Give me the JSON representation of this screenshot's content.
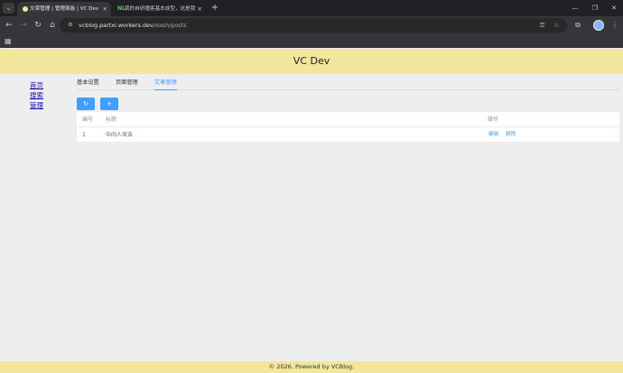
{
  "browser": {
    "tabs": [
      {
        "title": "文章管理 | 管理面板 | VC Dev",
        "active": true
      },
      {
        "title": "我的自研播客基本成型，这是我",
        "active": false,
        "favicon": "NL"
      }
    ],
    "url_host": "vcblog.partxi.workers.dev",
    "url_path": "/dash/posts"
  },
  "site": {
    "title": "VC Dev",
    "footer": "© 2026. Powered by VCBlog."
  },
  "sidebar": {
    "items": [
      {
        "label": "首页"
      },
      {
        "label": "搜索"
      },
      {
        "label": "管理"
      }
    ]
  },
  "tabs": [
    {
      "label": "基本设置"
    },
    {
      "label": "页面管理"
    },
    {
      "label": "文章管理"
    }
  ],
  "buttons": {
    "refresh_icon": "refresh-icon",
    "add_icon": "plus-icon"
  },
  "table": {
    "columns": [
      "编号",
      "标题",
      "操作"
    ],
    "rows": [
      {
        "id": "1",
        "title": "中间人攻击",
        "edit": "编辑",
        "delete": "删除"
      }
    ]
  },
  "colors": {
    "header_bg": "#f2e69b",
    "accent": "#409eff"
  }
}
